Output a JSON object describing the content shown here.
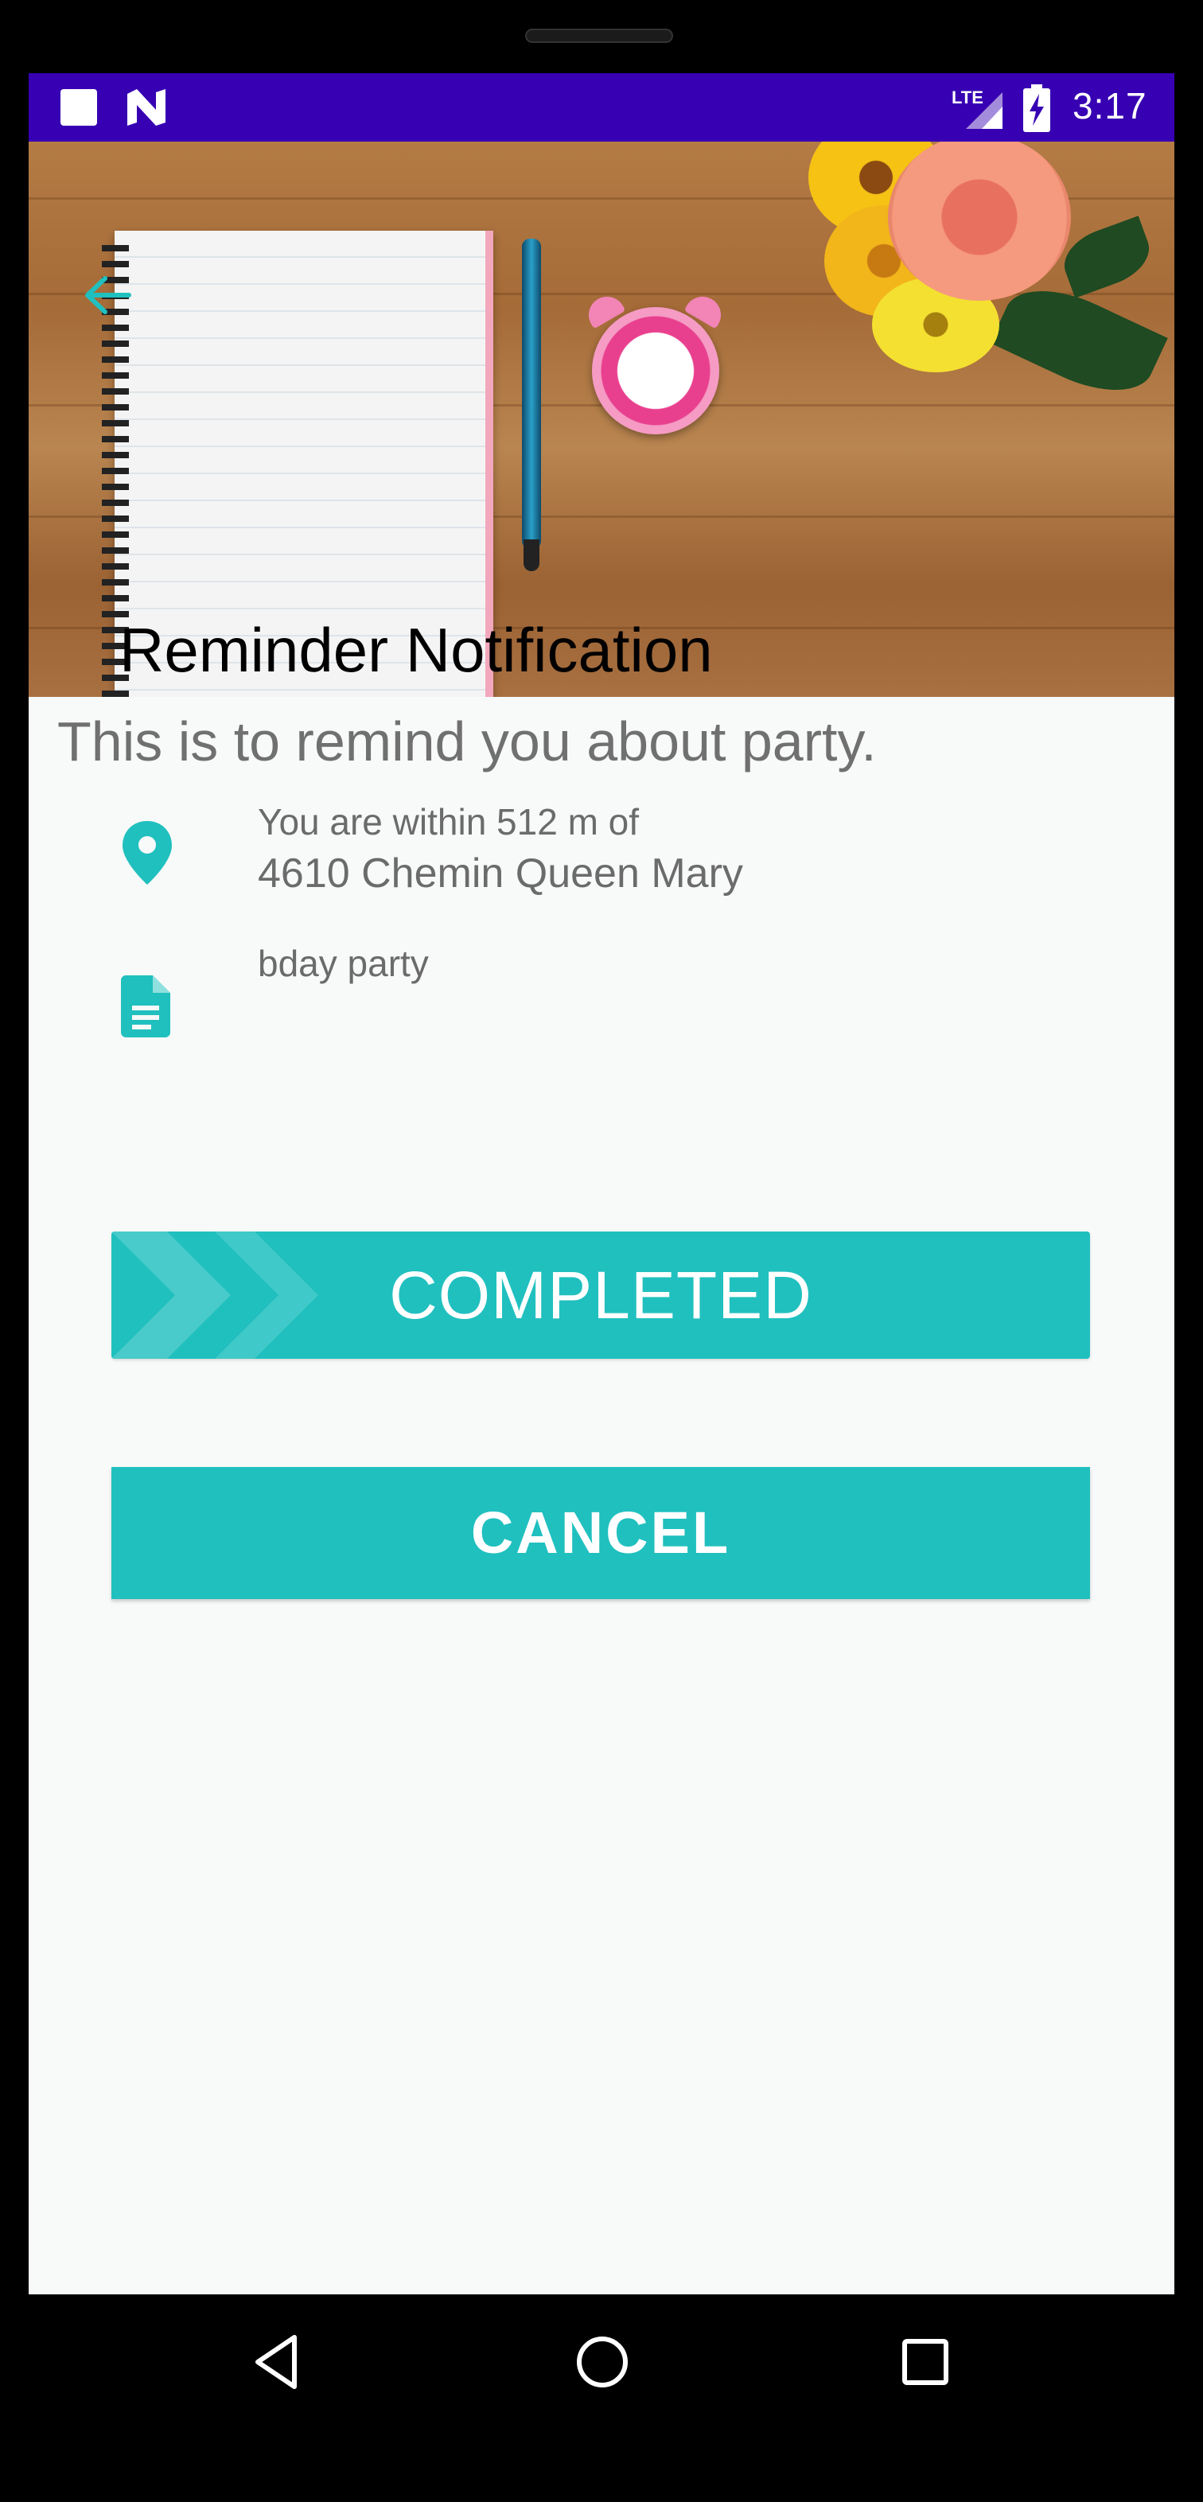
{
  "status_bar": {
    "network_label": "LTE",
    "time": "3:17"
  },
  "header": {
    "title": "Reminder Notification",
    "back_icon": "arrow-left-icon"
  },
  "reminder": {
    "subject": "This is to remind you about party.",
    "location": {
      "icon": "location-pin-icon",
      "distance_text": "You are within 512 m of",
      "address": "4610 Chemin Queen Mary"
    },
    "note": {
      "icon": "document-icon",
      "text": "bday party"
    }
  },
  "actions": {
    "completed_label": "COMPLETED",
    "cancel_label": "CANCEL"
  },
  "nav_bar": {
    "back_icon": "triangle-back-icon",
    "home_icon": "circle-home-icon",
    "recents_icon": "square-recents-icon"
  },
  "colors": {
    "status_bar": "#3700b3",
    "accent": "#20c0bf",
    "background": "#f8f9f9",
    "text_secondary": "#707070"
  }
}
